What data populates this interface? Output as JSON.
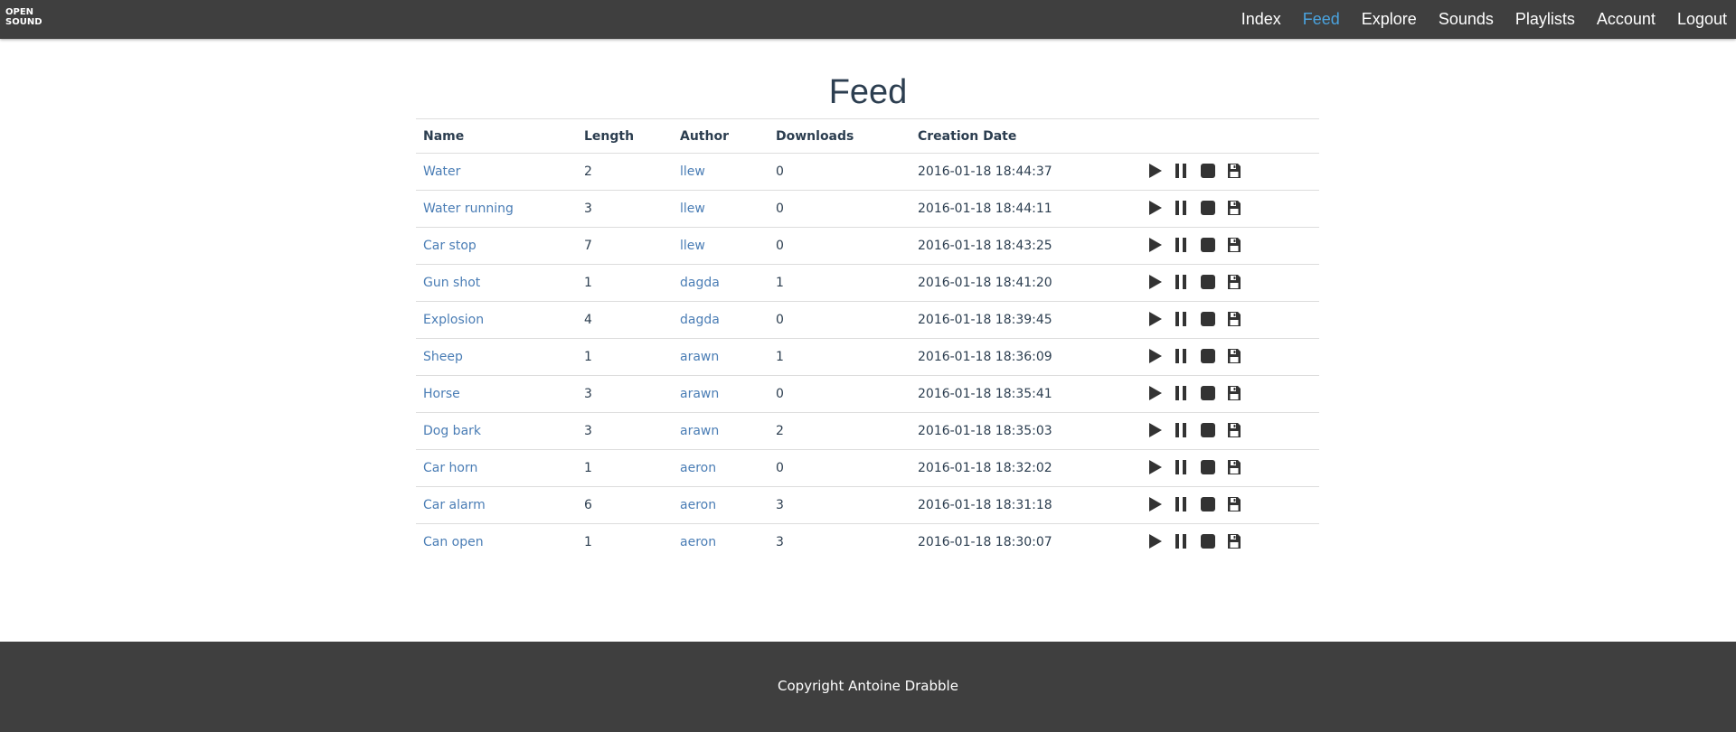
{
  "logo": {
    "line1": "OPEN",
    "line2": "SOUND"
  },
  "nav": {
    "items": [
      {
        "label": "Index",
        "active": false
      },
      {
        "label": "Feed",
        "active": true
      },
      {
        "label": "Explore",
        "active": false
      },
      {
        "label": "Sounds",
        "active": false
      },
      {
        "label": "Playlists",
        "active": false
      },
      {
        "label": "Account",
        "active": false
      },
      {
        "label": "Logout",
        "active": false
      }
    ],
    "active_color": "#4aa3df"
  },
  "page": {
    "title": "Feed"
  },
  "table": {
    "columns": [
      "Name",
      "Length",
      "Author",
      "Downloads",
      "Creation Date"
    ],
    "rows": [
      {
        "name": "Water",
        "length": "2",
        "author": "llew",
        "downloads": "0",
        "date": "2016-01-18 18:44:37"
      },
      {
        "name": "Water running",
        "length": "3",
        "author": "llew",
        "downloads": "0",
        "date": "2016-01-18 18:44:11"
      },
      {
        "name": "Car stop",
        "length": "7",
        "author": "llew",
        "downloads": "0",
        "date": "2016-01-18 18:43:25"
      },
      {
        "name": "Gun shot",
        "length": "1",
        "author": "dagda",
        "downloads": "1",
        "date": "2016-01-18 18:41:20"
      },
      {
        "name": "Explosion",
        "length": "4",
        "author": "dagda",
        "downloads": "0",
        "date": "2016-01-18 18:39:45"
      },
      {
        "name": "Sheep",
        "length": "1",
        "author": "arawn",
        "downloads": "1",
        "date": "2016-01-18 18:36:09"
      },
      {
        "name": "Horse",
        "length": "3",
        "author": "arawn",
        "downloads": "0",
        "date": "2016-01-18 18:35:41"
      },
      {
        "name": "Dog bark",
        "length": "3",
        "author": "arawn",
        "downloads": "2",
        "date": "2016-01-18 18:35:03"
      },
      {
        "name": "Car horn",
        "length": "1",
        "author": "aeron",
        "downloads": "0",
        "date": "2016-01-18 18:32:02"
      },
      {
        "name": "Car alarm",
        "length": "6",
        "author": "aeron",
        "downloads": "3",
        "date": "2016-01-18 18:31:18"
      },
      {
        "name": "Can open",
        "length": "1",
        "author": "aeron",
        "downloads": "3",
        "date": "2016-01-18 18:30:07"
      }
    ],
    "row_actions": [
      "play-icon",
      "pause-icon",
      "stop-icon",
      "save-icon"
    ],
    "link_color": "#4a7db5"
  },
  "footer": {
    "text": "Copyright Antoine Drabble"
  }
}
